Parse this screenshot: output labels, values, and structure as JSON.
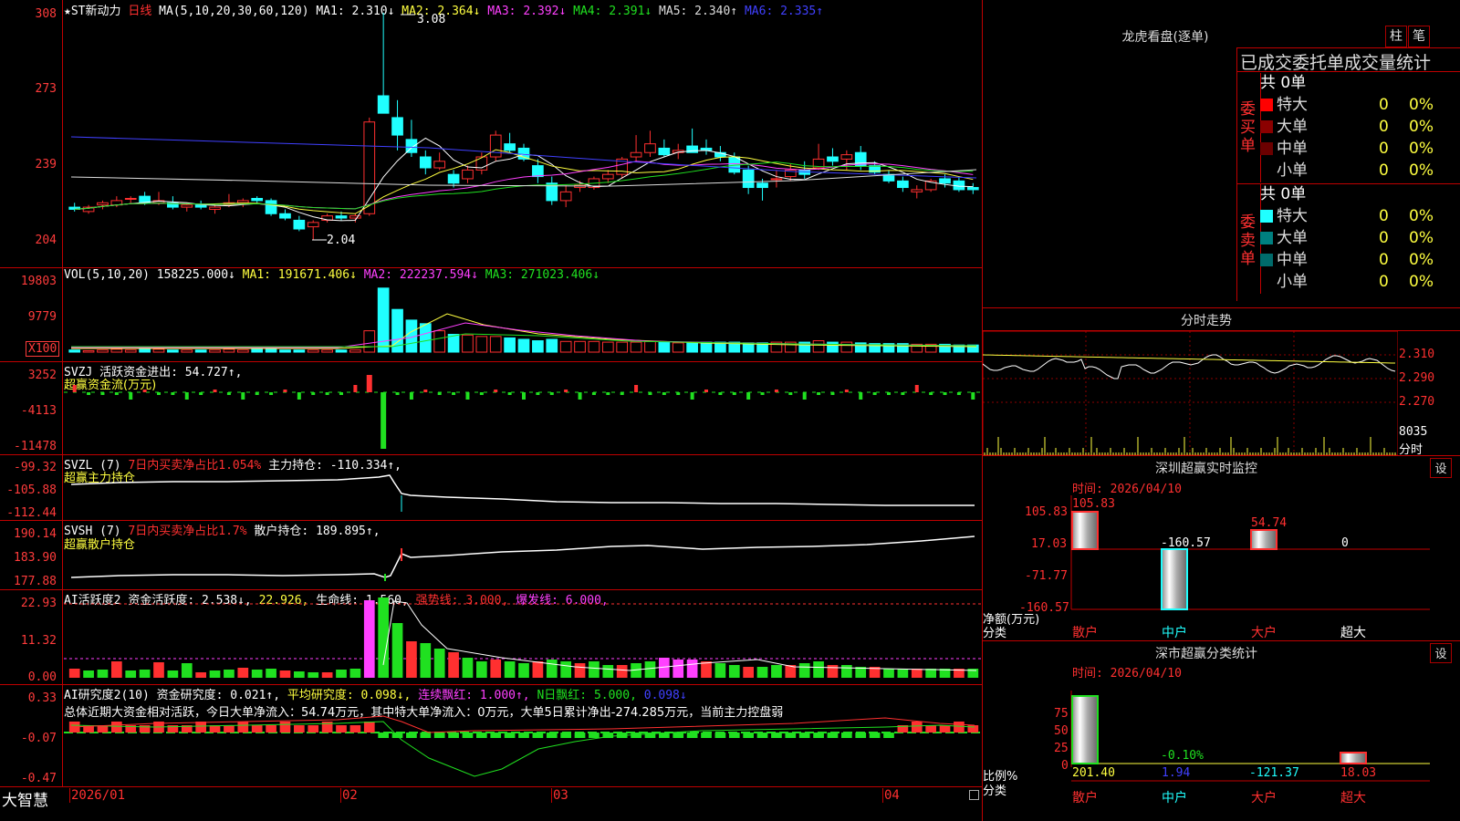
{
  "app": {
    "brand": "大智慧"
  },
  "price_panel": {
    "title": "★ST新动力",
    "period": "日线",
    "ma_header": "MA(5,10,20,30,60,120)",
    "ma": [
      {
        "label": "MA1:",
        "value": "2.310",
        "arrow": "↓",
        "color": "#ffffff"
      },
      {
        "label": "MA2:",
        "value": "2.364",
        "arrow": "↓",
        "color": "#ffff40"
      },
      {
        "label": "MA3:",
        "value": "2.392",
        "arrow": "↓",
        "color": "#ff40ff"
      },
      {
        "label": "MA4:",
        "value": "2.391",
        "arrow": "↓",
        "color": "#20e020"
      },
      {
        "label": "MA5:",
        "value": "2.340",
        "arrow": "↑",
        "color": "#dddddd"
      },
      {
        "label": "MA6:",
        "value": "2.335",
        "arrow": "↑",
        "color": "#4040ff"
      }
    ],
    "y_ticks": [
      "308",
      "273",
      "239",
      "204"
    ],
    "high_label": "3.08",
    "low_label": "2.04"
  },
  "vol_panel": {
    "header": "VOL(5,10,20)",
    "value": "158225.000↓",
    "ma1": "MA1: 191671.406↓",
    "ma2": "MA2: 222237.594↓",
    "ma3": "MA3: 271023.406↓",
    "y_ticks": [
      "19803",
      "9779"
    ],
    "unit": "X100"
  },
  "svzj_panel": {
    "header": "SVZJ",
    "label": "活跃资金进出: 54.727↑,",
    "subtitle": "超赢资金流(万元)",
    "y_ticks": [
      "3252",
      "-4113",
      "-11478"
    ]
  },
  "svzl_panel": {
    "header": "SVZL (7)",
    "ratio": "7日内买卖净占比1.054%",
    "holding": "主力持仓: -110.334↑,",
    "subtitle": "超赢主力持仓",
    "y_ticks": [
      "-99.32",
      "-105.88",
      "-112.44"
    ]
  },
  "svsh_panel": {
    "header": "SVSH (7)",
    "ratio": "7日内买卖净占比1.7%",
    "holding": "散户持仓: 189.895↑,",
    "subtitle": "超赢散户持仓",
    "y_ticks": [
      "190.14",
      "183.90",
      "177.88"
    ]
  },
  "ai_active_panel": {
    "header": "AI活跃度2",
    "l1": "资金活跃度: 2.538↓,",
    "l2": "22.926,",
    "l3": "生命线: 1.560,",
    "l4": "强势线: 3.000,",
    "l5": "爆发线: 6.000,",
    "y_ticks": [
      "22.93",
      "11.32",
      "0.00"
    ]
  },
  "ai_research_panel": {
    "header": "AI研究度2(10)",
    "l1": "资金研究度: 0.021↑,",
    "l2": "平均研究度: 0.098↓,",
    "l3": "连续飘红: 1.000↑,",
    "l4": "N日飘红: 5.000,",
    "l5": "0.098↓",
    "summary": "总体近期大资金相对活跃，今日大单净流入：54.74万元，其中特大单净流入：0万元，大单5日累计净出-274.285万元，当前主力控盘弱",
    "y_ticks": [
      "0.33",
      "-0.07",
      "-0.47"
    ]
  },
  "x_axis": {
    "labels": [
      "2026/01",
      "02",
      "03",
      "04"
    ]
  },
  "right": {
    "dragon_title": "龙虎看盘(逐单)",
    "btn_zhu": "柱",
    "btn_bi": "笔",
    "stats_title": "已成交委托单成交量统计",
    "buy_label": "委买单",
    "sell_label": "委卖单",
    "buy_total": "共 0单",
    "sell_total": "共 0单",
    "buy_rows": [
      {
        "name": "特大",
        "qty": "0",
        "pct": "0%",
        "color": "#ff0000"
      },
      {
        "name": "大单",
        "qty": "0",
        "pct": "0%",
        "color": "#8b0000"
      },
      {
        "name": "中单",
        "qty": "0",
        "pct": "0%",
        "color": "#6b0000"
      },
      {
        "name": "小单",
        "qty": "0",
        "pct": "0%",
        "color": ""
      }
    ],
    "sell_rows": [
      {
        "name": "特大",
        "qty": "0",
        "pct": "0%",
        "color": "#20ffff"
      },
      {
        "name": "大单",
        "qty": "0",
        "pct": "0%",
        "color": "#008080"
      },
      {
        "name": "中单",
        "qty": "0",
        "pct": "0%",
        "color": "#006a6a"
      },
      {
        "name": "小单",
        "qty": "0",
        "pct": "0%",
        "color": ""
      }
    ],
    "intraday_title": "分时走势",
    "intraday_ticks": [
      "2.310",
      "2.290",
      "2.270"
    ],
    "intraday_vol_ticks": [
      "8035",
      "分时"
    ],
    "monitor_title": "深圳超赢实时监控",
    "monitor_btn": "设",
    "monitor_time": "时间: 2026/04/10",
    "monitor_y": [
      "105.83",
      "17.03",
      "-71.77",
      "-160.57"
    ],
    "monitor_axis_label": "净额(万元)",
    "monitor_class_label": "分类",
    "monitor_values": [
      "105.83",
      "-160.57",
      "54.74",
      "0"
    ],
    "monitor_cats": [
      "散户",
      "中户",
      "大户",
      "超大"
    ],
    "class_title": "深市超赢分类统计",
    "class_btn": "设",
    "class_time": "时间: 2026/04/10",
    "class_y": [
      "75",
      "50",
      "25",
      "0"
    ],
    "class_axis_label": "比例%",
    "class_class_label": "分类",
    "class_values": [
      "201.40",
      "1.94",
      "-121.37",
      "18.03"
    ],
    "class_extra": "-0.10%",
    "class_cats": [
      "散户",
      "中户",
      "大户",
      "超大"
    ]
  },
  "chart_data": {
    "type": "candlestick",
    "price_range": [
      2.04,
      3.08
    ],
    "y_ticks_price": [
      3.08,
      2.73,
      2.39,
      2.04
    ],
    "vol_ticks": [
      19803,
      9779
    ]
  }
}
